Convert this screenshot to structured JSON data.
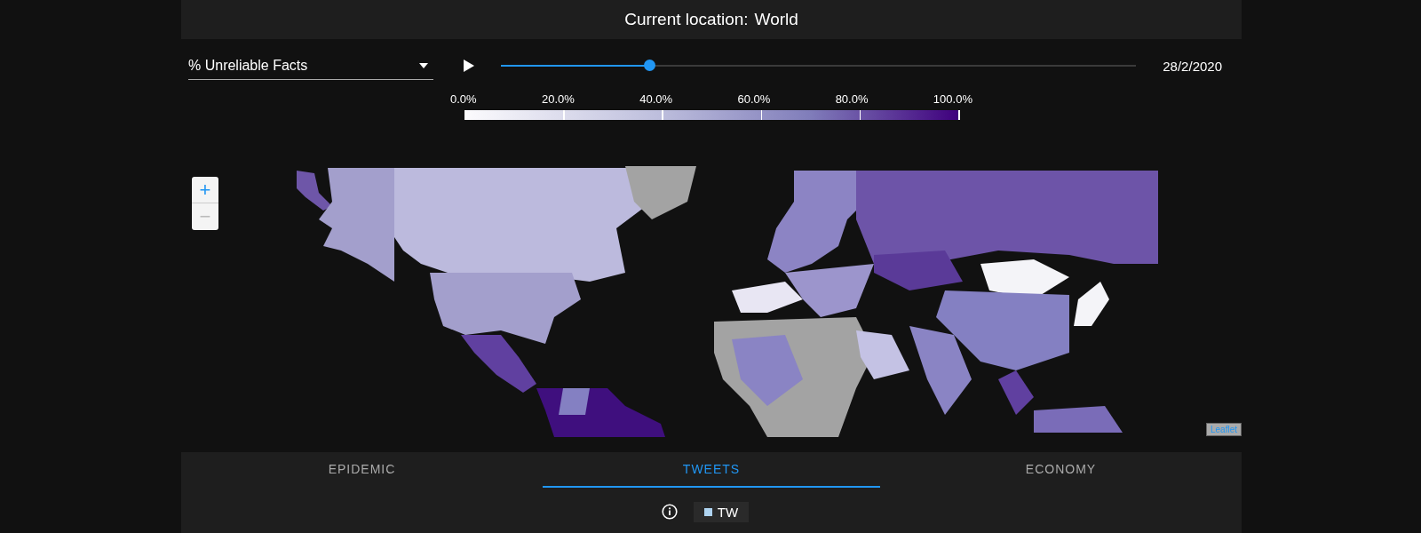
{
  "header": {
    "label": "Current location:",
    "location": "World"
  },
  "metric_select": {
    "value": "% Unreliable Facts"
  },
  "timeline": {
    "level": 0.233,
    "date": "28/2/2020"
  },
  "legend": {
    "ticks": [
      "0.0%",
      "20.0%",
      "40.0%",
      "60.0%",
      "80.0%",
      "100.0%"
    ]
  },
  "map": {
    "zoom_in": "+",
    "zoom_out": "−",
    "attribution": "Leaflet"
  },
  "tabs": [
    {
      "label": "EPIDEMIC",
      "selected": false
    },
    {
      "label": "TWEETS",
      "selected": true
    },
    {
      "label": "ECONOMY",
      "selected": false
    }
  ],
  "series_chips": [
    {
      "label": "TW",
      "color": "#aed3f0"
    }
  ]
}
